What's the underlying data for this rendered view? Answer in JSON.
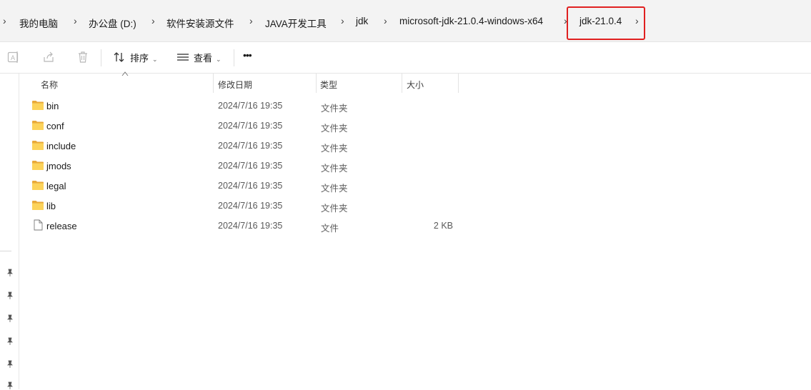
{
  "breadcrumb": {
    "items": [
      "我的电脑",
      "办公盘 (D:)",
      "软件安装源文件",
      "JAVA开发工具",
      "jdk",
      "microsoft-jdk-21.0.4-windows-x64",
      "jdk-21.0.4"
    ],
    "highlight_color": "#e02020"
  },
  "toolbar": {
    "sort_label": "排序",
    "view_label": "查看",
    "more_label": "•••"
  },
  "columns": {
    "name": "名称",
    "date": "修改日期",
    "type": "类型",
    "size": "大小"
  },
  "files": [
    {
      "name": "bin",
      "date": "2024/7/16 19:35",
      "type": "文件夹",
      "size": "",
      "icon": "folder-icon"
    },
    {
      "name": "conf",
      "date": "2024/7/16 19:35",
      "type": "文件夹",
      "size": "",
      "icon": "folder-icon"
    },
    {
      "name": "include",
      "date": "2024/7/16 19:35",
      "type": "文件夹",
      "size": "",
      "icon": "folder-icon"
    },
    {
      "name": "jmods",
      "date": "2024/7/16 19:35",
      "type": "文件夹",
      "size": "",
      "icon": "folder-icon"
    },
    {
      "name": "legal",
      "date": "2024/7/16 19:35",
      "type": "文件夹",
      "size": "",
      "icon": "folder-icon"
    },
    {
      "name": "lib",
      "date": "2024/7/16 19:35",
      "type": "文件夹",
      "size": "",
      "icon": "folder-icon"
    },
    {
      "name": "release",
      "date": "2024/7/16 19:35",
      "type": "文件",
      "size": "2 KB",
      "icon": "file-icon"
    }
  ]
}
